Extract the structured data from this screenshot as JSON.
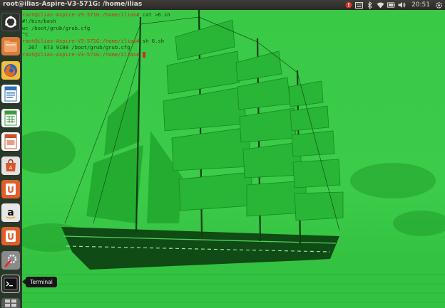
{
  "window_title": "root@ilias-Aspire-V3-571G: /home/ilias",
  "indicators": {
    "clock": "20:51"
  },
  "launcher": {
    "items": [
      {
        "name": "dash-home-icon",
        "glyph": "◉",
        "color": "#2a2a2a"
      },
      {
        "name": "files-icon",
        "glyph": "",
        "color": "#e4702e"
      },
      {
        "name": "firefox-icon",
        "glyph": "",
        "color": "#e16620"
      },
      {
        "name": "libreoffice-writer-icon",
        "glyph": "",
        "color": "#2f6fb7"
      },
      {
        "name": "libreoffice-calc-icon",
        "glyph": "",
        "color": "#3f9b3f"
      },
      {
        "name": "libreoffice-impress-icon",
        "glyph": "",
        "color": "#c9512c"
      },
      {
        "name": "ubuntu-software-center-icon",
        "glyph": "",
        "color": "#d9562a"
      },
      {
        "name": "ubuntu-one-icon",
        "glyph": "U",
        "color": "#e15f2a"
      },
      {
        "name": "amazon-icon",
        "glyph": "a",
        "color": "#e7e7e7"
      },
      {
        "name": "ubuntu-one-music-icon",
        "glyph": "U",
        "color": "#e15f2a"
      },
      {
        "name": "system-settings-icon",
        "glyph": "",
        "color": "#7a7a7a"
      },
      {
        "name": "terminal-icon",
        "glyph": ">_",
        "color": "#2d2d2d"
      },
      {
        "name": "workspace-switcher-icon",
        "glyph": "",
        "color": "#6a6a6a"
      }
    ],
    "tooltip": "Terminal"
  },
  "terminal": {
    "lines": [
      {
        "prompt": "root@ilias-Aspire-V3-571G:/home/ilias#",
        "command": " cat >6.sh"
      },
      {
        "output": "#!/bin/bash"
      },
      {
        "output": "wc /boot/grub/grub.cfg"
      },
      {
        "output": "^C"
      },
      {
        "prompt": "root@ilias-Aspire-V3-571G:/home/ilias#",
        "command": " sh 6.sh"
      },
      {
        "output": "  267  873 9108 /boot/grub/grub.cfg"
      },
      {
        "prompt": "root@ilias-Aspire-V3-571G:/home/ilias#",
        "command": " "
      }
    ]
  },
  "colors": {
    "tint": "#33c840",
    "prompt": "#d12b18",
    "output": "#1f3a16"
  }
}
